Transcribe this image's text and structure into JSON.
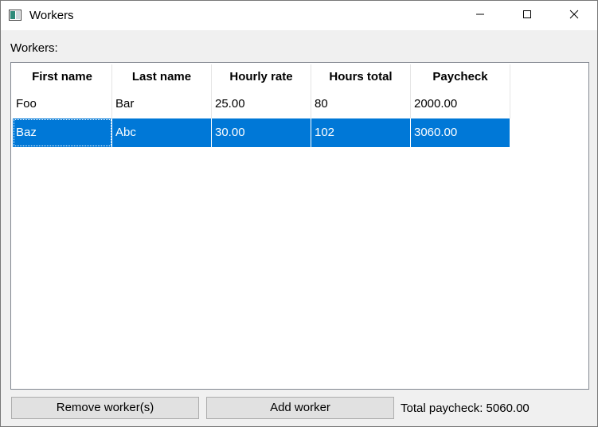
{
  "window": {
    "title": "Workers",
    "icon": "app-window-icon",
    "controls": [
      "minimize-icon",
      "maximize-icon",
      "close-icon"
    ]
  },
  "workers_label": "Workers:",
  "table": {
    "columns": [
      "First name",
      "Last name",
      "Hourly rate",
      "Hours total",
      "Paycheck"
    ],
    "rows": [
      {
        "first": "Foo",
        "last": "Bar",
        "rate": "25.00",
        "hours": "80",
        "paycheck": "2000.00",
        "selected": false
      },
      {
        "first": "Baz",
        "last": "Abc",
        "rate": "30.00",
        "hours": "102",
        "paycheck": "3060.00",
        "selected": true
      }
    ],
    "selection_color": "#0078d7"
  },
  "buttons": {
    "remove": "Remove worker(s)",
    "add": "Add worker"
  },
  "total_paycheck": "Total paycheck: 5060.00"
}
